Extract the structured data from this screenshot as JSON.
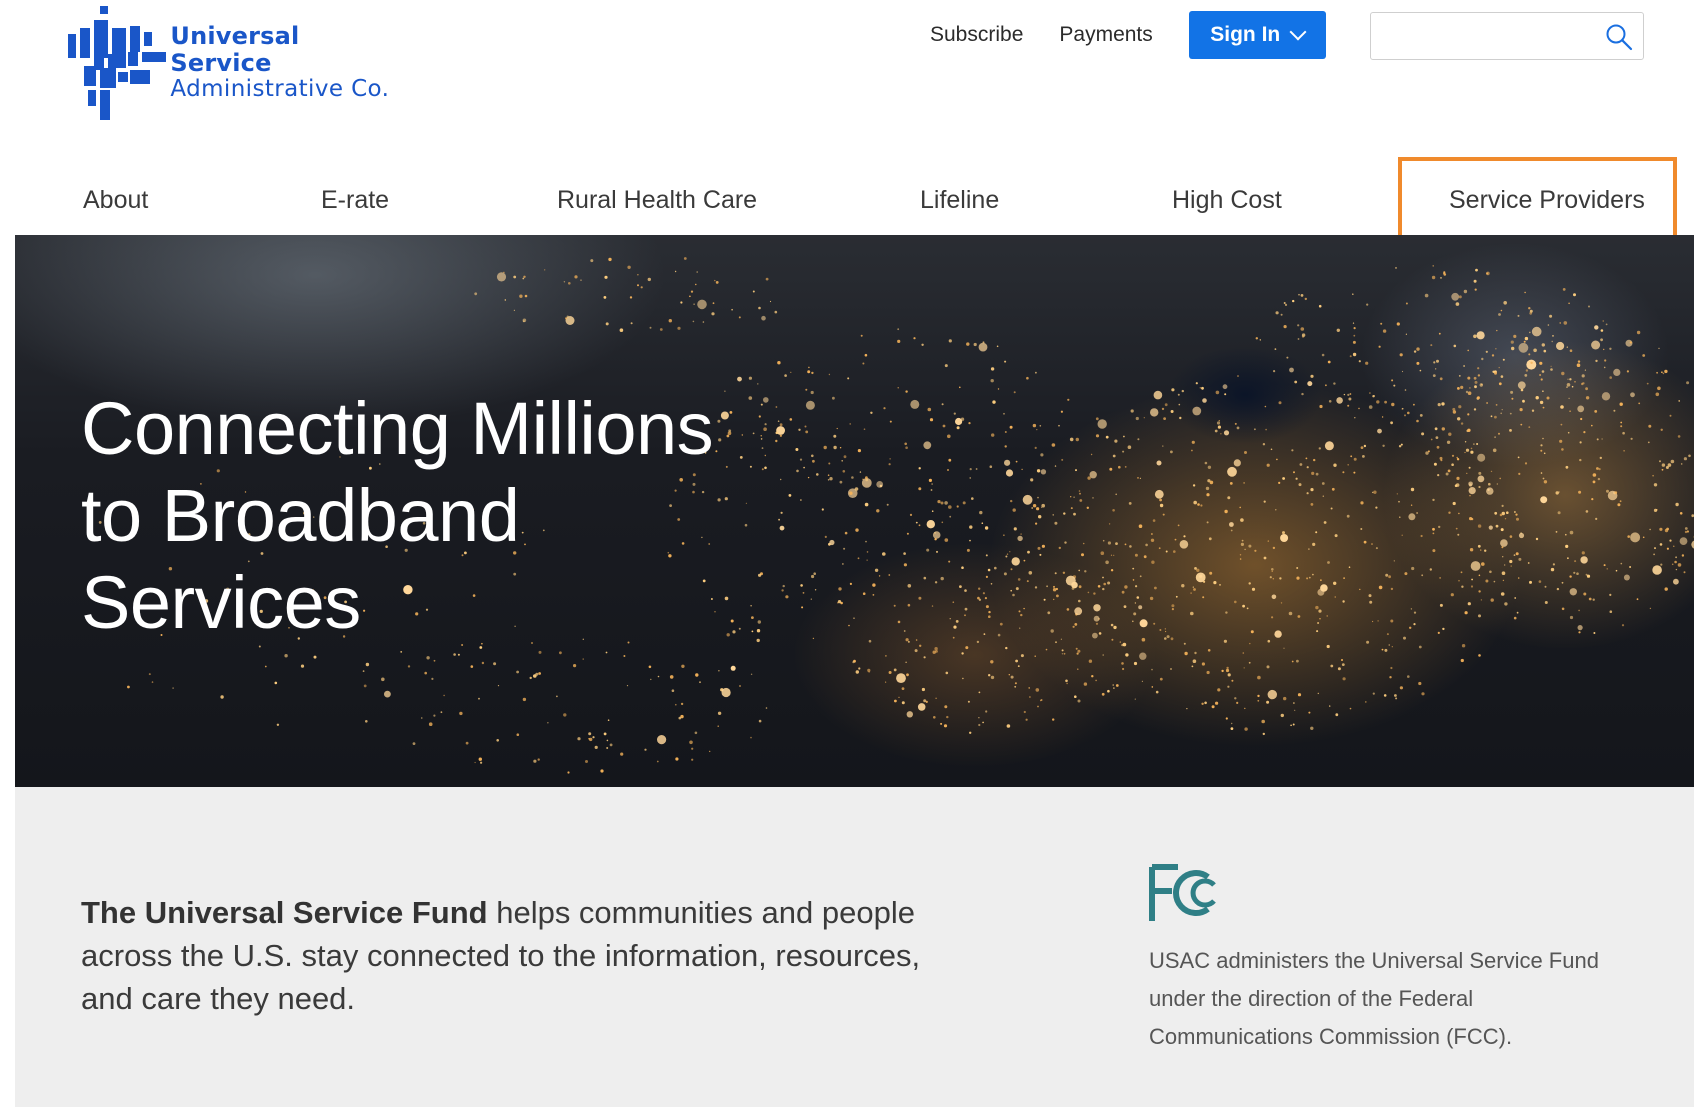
{
  "brand": {
    "name_line1": "Universal Service",
    "name_line2": "Administrative Co.",
    "color": "#1a56c8"
  },
  "utility": {
    "subscribe": "Subscribe",
    "payments": "Payments",
    "signin": "Sign In",
    "search_placeholder": ""
  },
  "nav": {
    "items": [
      {
        "label": "About"
      },
      {
        "label": "E-rate"
      },
      {
        "label": "Rural Health Care"
      },
      {
        "label": "Lifeline"
      },
      {
        "label": "High Cost"
      },
      {
        "label": "Service Providers",
        "highlighted": true
      }
    ],
    "highlight_color": "#f08a2c"
  },
  "hero": {
    "title_line1": "Connecting Millions",
    "title_line2": "to Broadband",
    "title_line3": "Services"
  },
  "mission": {
    "bold": "The Universal Service Fund",
    "rest": " helps communities and people across the U.S. stay connected to the information, resources, and care they need."
  },
  "fcc": {
    "logo_text": "FCC",
    "description": "USAC administers the Universal Service Fund under the direction of the Federal Communications Commission (FCC)."
  },
  "colors": {
    "signin_bg": "#1273e6",
    "band_bg": "#eeeeee"
  }
}
